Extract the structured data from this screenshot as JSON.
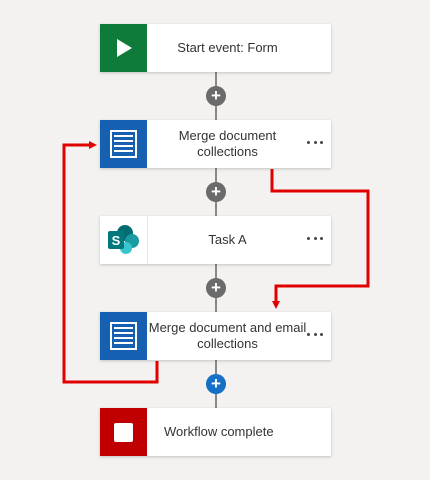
{
  "workflow": {
    "steps": [
      {
        "label": "Start event: Form",
        "icon": "play-icon",
        "color": "#0f7b3a",
        "has_menu": false
      },
      {
        "label": "Merge document collections",
        "icon": "document-list-icon",
        "color": "#1660b1",
        "has_menu": true
      },
      {
        "label": "Task A",
        "icon": "sharepoint-icon",
        "color": "#ffffff",
        "has_menu": true
      },
      {
        "label": "Merge document and email collections",
        "icon": "document-list-icon",
        "color": "#1660b1",
        "has_menu": true
      },
      {
        "label": "Workflow complete",
        "icon": "stop-icon",
        "color": "#c00000",
        "has_menu": false
      }
    ],
    "add_buttons": [
      {
        "symbol": "+",
        "active": false
      },
      {
        "symbol": "+",
        "active": false
      },
      {
        "symbol": "+",
        "active": false
      },
      {
        "symbol": "+",
        "active": true
      }
    ]
  },
  "annotation_color": "#e00000"
}
